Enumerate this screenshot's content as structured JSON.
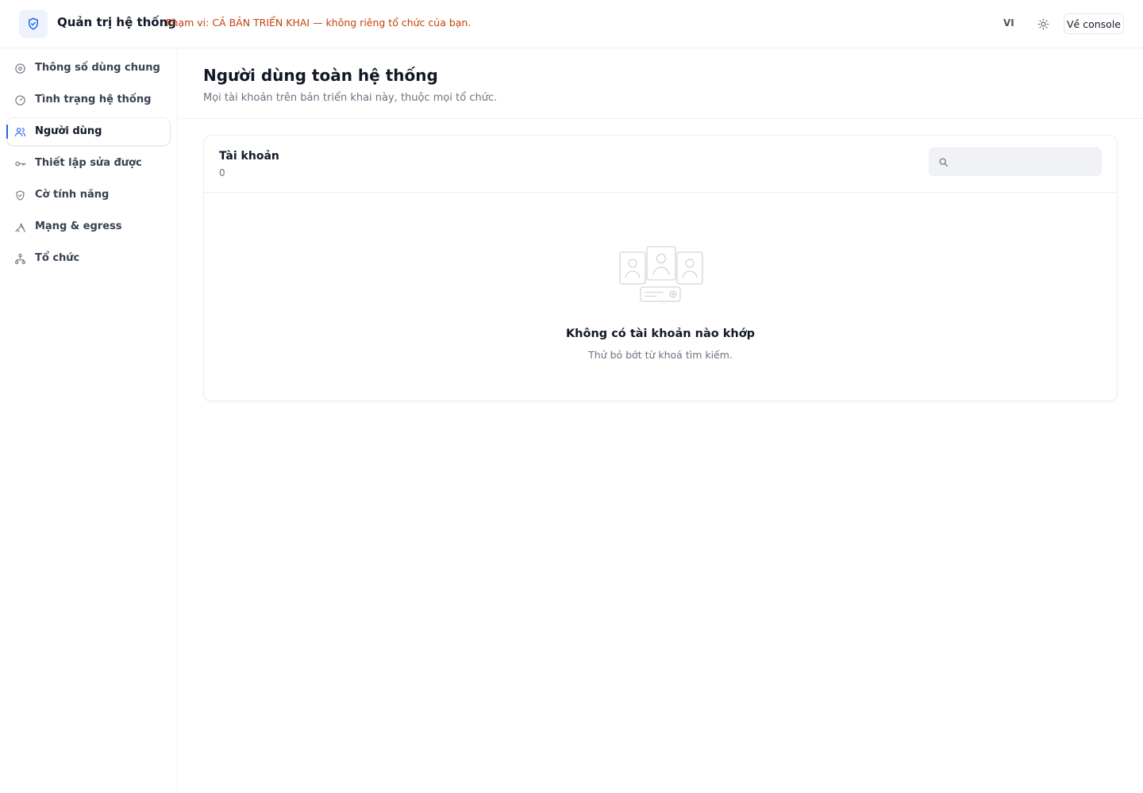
{
  "header": {
    "title": "Quản trị hệ thống",
    "scope_note": "Phạm vi: CẢ BẢN TRIỂN KHAI — không riêng tổ chức của bạn.",
    "language": "VI",
    "console_button": "Về console",
    "logo_icon": "shield-check-icon",
    "theme_icon": "sun-icon"
  },
  "sidebar": {
    "items": [
      {
        "label": "Thông số dùng chung",
        "icon": "settings-icon",
        "active": false
      },
      {
        "label": "Tình trạng hệ thống",
        "icon": "gauge-icon",
        "active": false
      },
      {
        "label": "Người dùng",
        "icon": "users-icon",
        "active": true
      },
      {
        "label": "Thiết lập sửa được",
        "icon": "key-icon",
        "active": false
      },
      {
        "label": "Cờ tính năng",
        "icon": "shield-icon",
        "active": false
      },
      {
        "label": "Mạng & egress",
        "icon": "network-icon",
        "active": false
      },
      {
        "label": "Tổ chức",
        "icon": "org-tree-icon",
        "active": false
      }
    ]
  },
  "page": {
    "title": "Người dùng toàn hệ thống",
    "subtitle": "Mọi tài khoản trên bản triển khai này, thuộc mọi tổ chức."
  },
  "accounts": {
    "title": "Tài khoản",
    "count": "0",
    "search_value": "",
    "search_placeholder": "",
    "empty_title": "Không có tài khoản nào khớp",
    "empty_subtitle": "Thử bỏ bớt từ khoá tìm kiếm."
  },
  "colors": {
    "accent": "#2563eb",
    "warning": "#c2410c",
    "muted": "#6b7280"
  }
}
